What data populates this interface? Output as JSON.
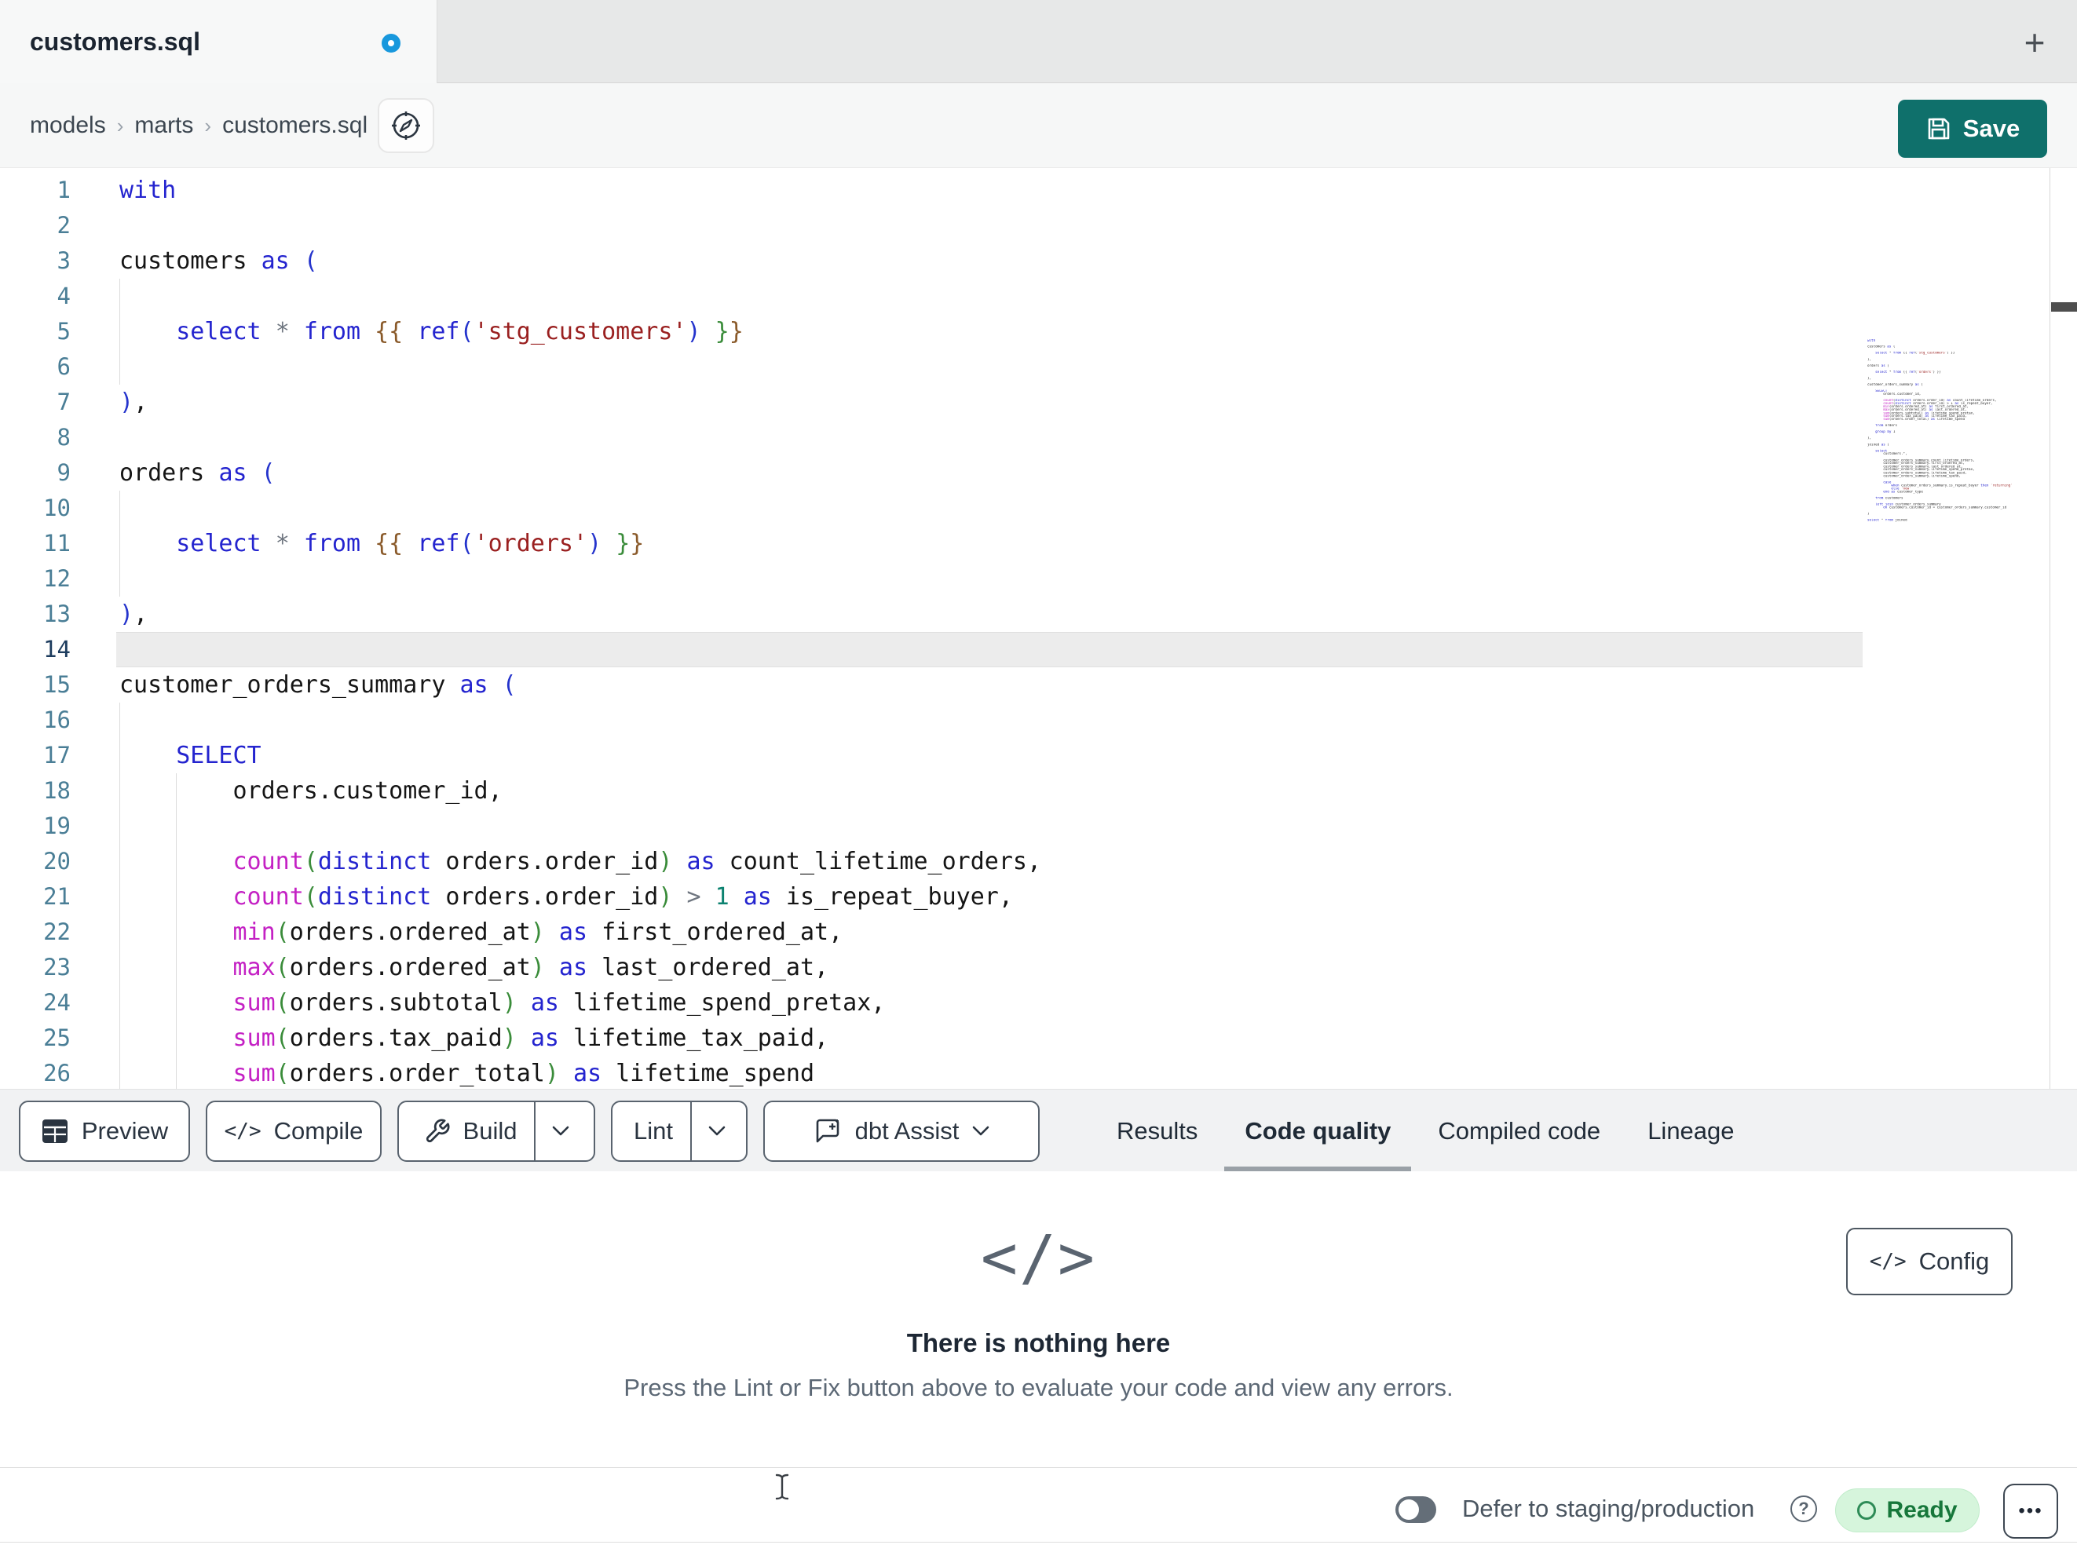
{
  "tab_bar": {
    "active_tab_title": "customers.sql",
    "new_tab_icon": "+"
  },
  "breadcrumb": {
    "items": [
      "models",
      "marts",
      "customers.sql"
    ],
    "separator": "›"
  },
  "save_button": {
    "label": "Save"
  },
  "editor": {
    "active_line": 14,
    "lines": [
      {
        "n": 1,
        "tokens": [
          [
            "k",
            "with"
          ]
        ]
      },
      {
        "n": 2,
        "tokens": []
      },
      {
        "n": 3,
        "tokens": [
          [
            "p",
            "customers "
          ],
          [
            "k",
            "as"
          ],
          [
            "p",
            " "
          ],
          [
            "b",
            "("
          ]
        ]
      },
      {
        "n": 4,
        "tokens": []
      },
      {
        "n": 5,
        "tokens": [
          [
            "p",
            "    "
          ],
          [
            "k",
            "select"
          ],
          [
            "p",
            " "
          ],
          [
            "o",
            "*"
          ],
          [
            "p",
            " "
          ],
          [
            "k",
            "from"
          ],
          [
            "p",
            " "
          ],
          [
            "w",
            "{{"
          ],
          [
            "p",
            " "
          ],
          [
            "k",
            "ref"
          ],
          [
            "b",
            "("
          ],
          [
            "s",
            "'stg_customers'"
          ],
          [
            "b",
            ")"
          ],
          [
            "p",
            " "
          ],
          [
            "g",
            "}"
          ],
          [
            "w",
            "}"
          ]
        ]
      },
      {
        "n": 6,
        "tokens": []
      },
      {
        "n": 7,
        "tokens": [
          [
            "b",
            ")"
          ],
          [
            "p",
            ","
          ]
        ]
      },
      {
        "n": 8,
        "tokens": []
      },
      {
        "n": 9,
        "tokens": [
          [
            "p",
            "orders "
          ],
          [
            "k",
            "as"
          ],
          [
            "p",
            " "
          ],
          [
            "b",
            "("
          ]
        ]
      },
      {
        "n": 10,
        "tokens": []
      },
      {
        "n": 11,
        "tokens": [
          [
            "p",
            "    "
          ],
          [
            "k",
            "select"
          ],
          [
            "p",
            " "
          ],
          [
            "o",
            "*"
          ],
          [
            "p",
            " "
          ],
          [
            "k",
            "from"
          ],
          [
            "p",
            " "
          ],
          [
            "w",
            "{{"
          ],
          [
            "p",
            " "
          ],
          [
            "k",
            "ref"
          ],
          [
            "b",
            "("
          ],
          [
            "s",
            "'orders'"
          ],
          [
            "b",
            ")"
          ],
          [
            "p",
            " "
          ],
          [
            "g",
            "}"
          ],
          [
            "w",
            "}"
          ]
        ]
      },
      {
        "n": 12,
        "tokens": []
      },
      {
        "n": 13,
        "tokens": [
          [
            "b",
            ")"
          ],
          [
            "p",
            ","
          ]
        ]
      },
      {
        "n": 14,
        "tokens": []
      },
      {
        "n": 15,
        "tokens": [
          [
            "p",
            "customer_orders_summary "
          ],
          [
            "k",
            "as"
          ],
          [
            "p",
            " "
          ],
          [
            "b",
            "("
          ]
        ]
      },
      {
        "n": 16,
        "tokens": []
      },
      {
        "n": 17,
        "tokens": [
          [
            "p",
            "    "
          ],
          [
            "k",
            "SELECT"
          ]
        ]
      },
      {
        "n": 18,
        "tokens": [
          [
            "p",
            "        orders.customer_id,"
          ]
        ]
      },
      {
        "n": 19,
        "tokens": []
      },
      {
        "n": 20,
        "tokens": [
          [
            "p",
            "        "
          ],
          [
            "f",
            "count"
          ],
          [
            "g",
            "("
          ],
          [
            "k",
            "distinct"
          ],
          [
            "p",
            " orders.order_id"
          ],
          [
            "g",
            ")"
          ],
          [
            "p",
            " "
          ],
          [
            "k",
            "as"
          ],
          [
            "p",
            " count_lifetime_orders,"
          ]
        ]
      },
      {
        "n": 21,
        "tokens": [
          [
            "p",
            "        "
          ],
          [
            "f",
            "count"
          ],
          [
            "g",
            "("
          ],
          [
            "k",
            "distinct"
          ],
          [
            "p",
            " orders.order_id"
          ],
          [
            "g",
            ")"
          ],
          [
            "p",
            " "
          ],
          [
            "o",
            ">"
          ],
          [
            "p",
            " "
          ],
          [
            "n",
            "1"
          ],
          [
            "p",
            " "
          ],
          [
            "k",
            "as"
          ],
          [
            "p",
            " is_repeat_buyer,"
          ]
        ]
      },
      {
        "n": 22,
        "tokens": [
          [
            "p",
            "        "
          ],
          [
            "f",
            "min"
          ],
          [
            "g",
            "("
          ],
          [
            "p",
            "orders.ordered_at"
          ],
          [
            "g",
            ")"
          ],
          [
            "p",
            " "
          ],
          [
            "k",
            "as"
          ],
          [
            "p",
            " first_ordered_at,"
          ]
        ]
      },
      {
        "n": 23,
        "tokens": [
          [
            "p",
            "        "
          ],
          [
            "f",
            "max"
          ],
          [
            "g",
            "("
          ],
          [
            "p",
            "orders.ordered_at"
          ],
          [
            "g",
            ")"
          ],
          [
            "p",
            " "
          ],
          [
            "k",
            "as"
          ],
          [
            "p",
            " last_ordered_at,"
          ]
        ]
      },
      {
        "n": 24,
        "tokens": [
          [
            "p",
            "        "
          ],
          [
            "f",
            "sum"
          ],
          [
            "g",
            "("
          ],
          [
            "p",
            "orders.subtotal"
          ],
          [
            "g",
            ")"
          ],
          [
            "p",
            " "
          ],
          [
            "k",
            "as"
          ],
          [
            "p",
            " lifetime_spend_pretax,"
          ]
        ]
      },
      {
        "n": 25,
        "tokens": [
          [
            "p",
            "        "
          ],
          [
            "f",
            "sum"
          ],
          [
            "g",
            "("
          ],
          [
            "p",
            "orders.tax_paid"
          ],
          [
            "g",
            ")"
          ],
          [
            "p",
            " "
          ],
          [
            "k",
            "as"
          ],
          [
            "p",
            " lifetime_tax_paid,"
          ]
        ]
      },
      {
        "n": 26,
        "tokens": [
          [
            "p",
            "        "
          ],
          [
            "f",
            "sum"
          ],
          [
            "g",
            "("
          ],
          [
            "p",
            "orders.order_total"
          ],
          [
            "g",
            ")"
          ],
          [
            "p",
            " "
          ],
          [
            "k",
            "as"
          ],
          [
            "p",
            " lifetime_spend"
          ]
        ]
      }
    ],
    "minimap_lines": [
      "with",
      "",
      "customers as (",
      "",
      "    select * from {{ ref('stg_customers') }}",
      "",
      "),",
      "",
      "orders as (",
      "",
      "    select * from {{ ref('orders') }}",
      "",
      "),",
      "",
      "customer_orders_summary as (",
      "",
      "    SELECT",
      "        orders.customer_id,",
      "",
      "        count(distinct orders.order_id) as count_lifetime_orders,",
      "        count(distinct orders.order_id) > 1 as is_repeat_buyer,",
      "        min(orders.ordered_at) as first_ordered_at,",
      "        max(orders.ordered_at) as last_ordered_at,",
      "        sum(orders.subtotal) as lifetime_spend_pretax,",
      "        sum(orders.tax_paid) as lifetime_tax_paid,",
      "        sum(orders.order_total) as lifetime_spend",
      "",
      "    from orders",
      "",
      "    group by 1",
      "",
      "),",
      "",
      "joined as (",
      "",
      "    select",
      "        customers.*,",
      "",
      "        customer_orders_summary.count_lifetime_orders,",
      "        customer_orders_summary.first_ordered_at,",
      "        customer_orders_summary.last_ordered_at,",
      "        customer_orders_summary.lifetime_spend_pretax,",
      "        customer_orders_summary.lifetime_tax_paid,",
      "        customer_orders_summary.lifetime_spend,",
      "",
      "        case",
      "            when customer_orders_summary.is_repeat_buyer then 'returning'",
      "            else 'new'",
      "        end as customer_type",
      "",
      "    from customers",
      "",
      "    left join customer_orders_summary",
      "        on customers.customer_id = customer_orders_summary.customer_id",
      "",
      ")",
      "",
      "select * from joined"
    ]
  },
  "toolbar": {
    "preview_label": "Preview",
    "compile_label": "Compile",
    "build_label": "Build",
    "lint_label": "Lint",
    "assist_label": "dbt Assist",
    "compile_icon": "</>"
  },
  "panel_tabs": [
    {
      "label": "Results",
      "active": false
    },
    {
      "label": "Code quality",
      "active": true
    },
    {
      "label": "Compiled code",
      "active": false
    },
    {
      "label": "Lineage",
      "active": false
    }
  ],
  "empty_state": {
    "icon": "</>",
    "title": "There is nothing here",
    "subtitle": "Press the Lint or Fix button above to evaluate your code and view any errors."
  },
  "config_button": {
    "icon": "</>",
    "label": "Config"
  },
  "status_bar": {
    "defer_label": "Defer to staging/production",
    "help_icon": "?",
    "ready_label": "Ready",
    "more_icon": "•••"
  },
  "colors": {
    "accent_teal": "#0f706b",
    "unsaved_dot_blue": "#1898dd",
    "ready_bg": "#d6f5dc",
    "ready_text": "#17773b",
    "syntax": {
      "keyword": "#2424cf",
      "function": "#c421c4",
      "string": "#9a2020",
      "number": "#0c8270",
      "bracket_blue": "#2433cc",
      "bracket_green": "#3a8c3a",
      "bracket_brown": "#8a5a2a",
      "line_number": "#4a7e96"
    }
  }
}
